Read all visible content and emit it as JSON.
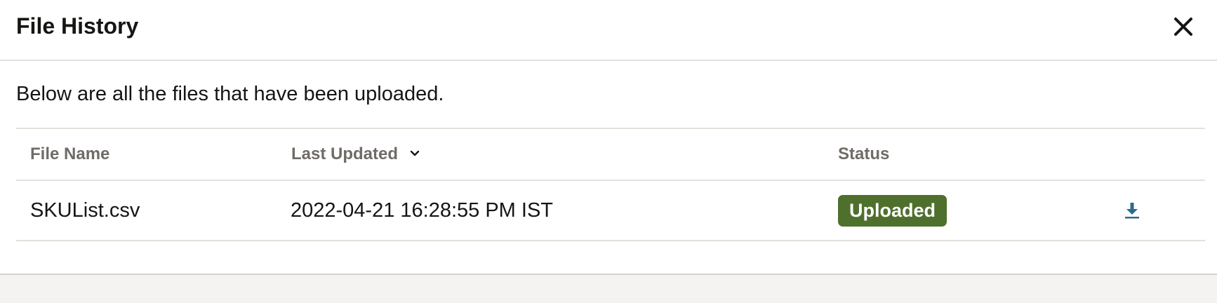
{
  "dialog": {
    "title": "File History",
    "close_icon": "close-icon",
    "intro_text": "Below are all the files that have been uploaded."
  },
  "table": {
    "columns": [
      {
        "label": "File Name"
      },
      {
        "label": "Last Updated",
        "sort_icon": "chevron-down-icon",
        "sorted": "descending"
      },
      {
        "label": "Status"
      },
      {
        "label": ""
      }
    ],
    "rows": [
      {
        "file_name": "SKUList.csv",
        "last_updated": "2022-04-21 16:28:55 PM IST",
        "status": "Uploaded",
        "action_icon": "download-icon"
      }
    ]
  },
  "colors": {
    "status_uploaded_bg": "#4f6f2c",
    "status_uploaded_text": "#ffffff",
    "header_text": "#6f6c68",
    "body_text": "#161513",
    "download_icon": "#2b6b8f",
    "divider": "#e4e1dd"
  }
}
